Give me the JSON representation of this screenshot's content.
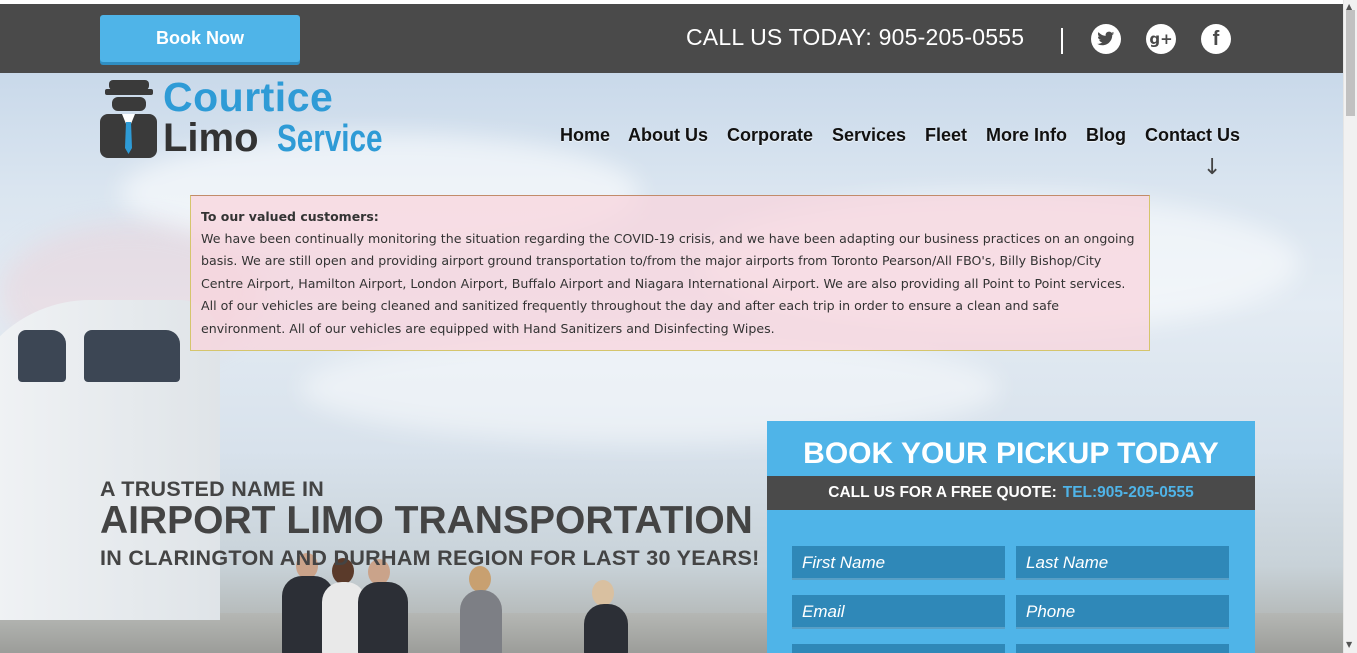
{
  "header": {
    "book_now_label": "Book Now",
    "call_us_text": "CALL US TODAY: 905-205-0555",
    "social": [
      "twitter-icon",
      "google-plus-icon",
      "facebook-icon"
    ]
  },
  "logo": {
    "line1": "Courtice",
    "line2_a": "Limo",
    "line2_b": "Service"
  },
  "nav": {
    "items": [
      "Home",
      "About Us",
      "Corporate",
      "Services",
      "Fleet",
      "More Info",
      "Blog",
      "Contact Us"
    ]
  },
  "notice": {
    "title": "To our valued customers:",
    "body": "We have been continually monitoring the situation regarding the COVID-19 crisis, and we have been adapting our business practices on an ongoing basis. We are still open and providing airport ground transportation to/from the major airports from Toronto Pearson/All FBO's, Billy Bishop/City Centre Airport, Hamilton Airport, London Airport, Buffalo Airport and Niagara International Airport. We are also providing all Point to Point services. All of our vehicles are being cleaned and sanitized frequently throughout the day and after each trip in order to ensure a clean and safe environment. All of our vehicles are equipped with Hand Sanitizers and Disinfecting Wipes."
  },
  "tagline": {
    "line1": "A TRUSTED NAME IN",
    "line2": "AIRPORT LIMO TRANSPORTATION",
    "line3": "IN CLARINGTON AND DURHAM REGION FOR LAST 30 YEARS!"
  },
  "booking": {
    "title": "BOOK YOUR PICKUP TODAY",
    "quote_text": "CALL US FOR A FREE QUOTE:",
    "quote_tel": "TEL:905-205-0555",
    "fields": {
      "first_name": "First Name",
      "last_name": "Last Name",
      "email": "Email",
      "phone": "Phone"
    }
  },
  "colors": {
    "topbar": "#4a4a4a",
    "accent": "#4fb4e8",
    "logo_blue": "#2e9bd6"
  }
}
